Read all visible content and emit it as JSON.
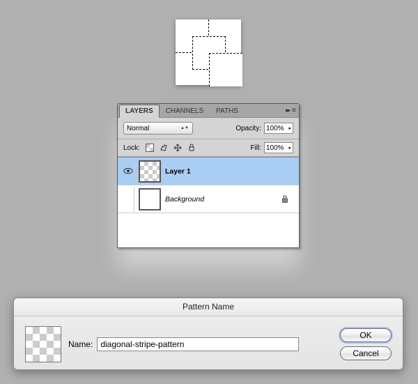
{
  "panel": {
    "tabs": {
      "layers": "LAYERS",
      "channels": "CHANNELS",
      "paths": "PATHS"
    },
    "blend_mode": "Normal",
    "opacity_label": "Opacity:",
    "opacity_value": "100%",
    "lock_label": "Lock:",
    "fill_label": "Fill:",
    "fill_value": "100%"
  },
  "layers": [
    {
      "name": "Layer 1",
      "italic": false,
      "visible": true,
      "locked": false,
      "selected": true,
      "checker_thumb": true
    },
    {
      "name": "Background",
      "italic": true,
      "visible": false,
      "locked": true,
      "selected": false,
      "checker_thumb": false
    }
  ],
  "dialog": {
    "title": "Pattern Name",
    "name_label": "Name:",
    "name_value": "diagonal-stripe-pattern",
    "ok": "OK",
    "cancel": "Cancel"
  }
}
